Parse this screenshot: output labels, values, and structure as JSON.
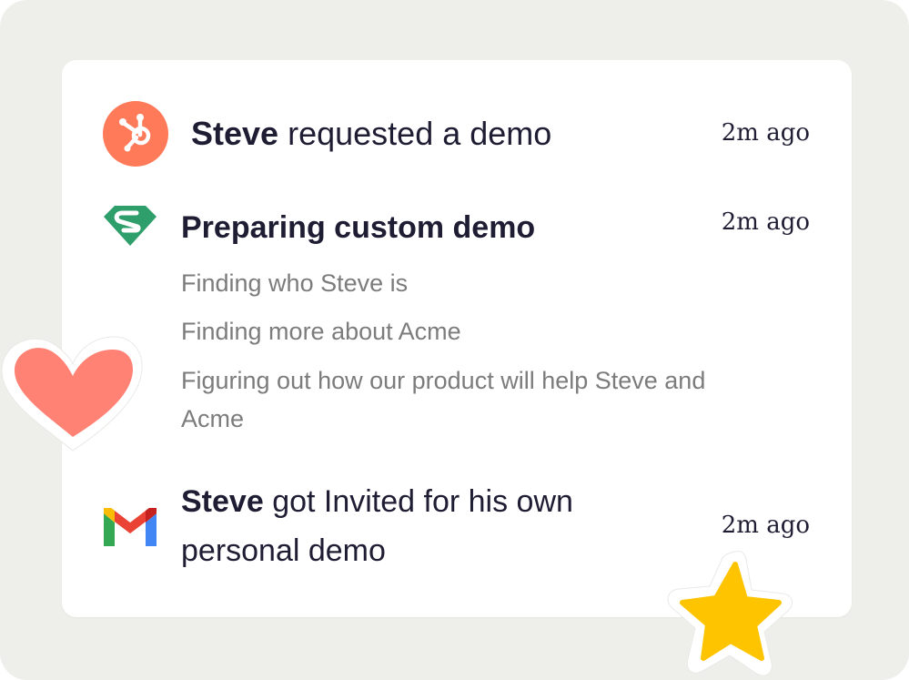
{
  "activity": {
    "items": [
      {
        "icon": "hubspot-icon",
        "actor": "Steve",
        "text": "requested a demo",
        "time": "2m ago"
      },
      {
        "icon": "superman-icon",
        "title": "Preparing custom demo",
        "time": "2m ago",
        "steps": [
          "Finding who Steve is",
          "Finding more about Acme",
          "Figuring out how our product will help Steve and Acme"
        ]
      },
      {
        "icon": "gmail-icon",
        "actor": "Steve",
        "text": "got Invited for his own personal demo",
        "time": "2m ago"
      }
    ]
  },
  "stickers": [
    "heart-sticker",
    "star-sticker"
  ],
  "colors": {
    "background": "#eeeeea",
    "card": "#ffffff",
    "text": "#1f1d33",
    "muted": "#7c7c7c",
    "hubspot": "#ff7a59",
    "superman": "#2e9e6a",
    "heart": "#ff8274",
    "star": "#ffc400"
  }
}
